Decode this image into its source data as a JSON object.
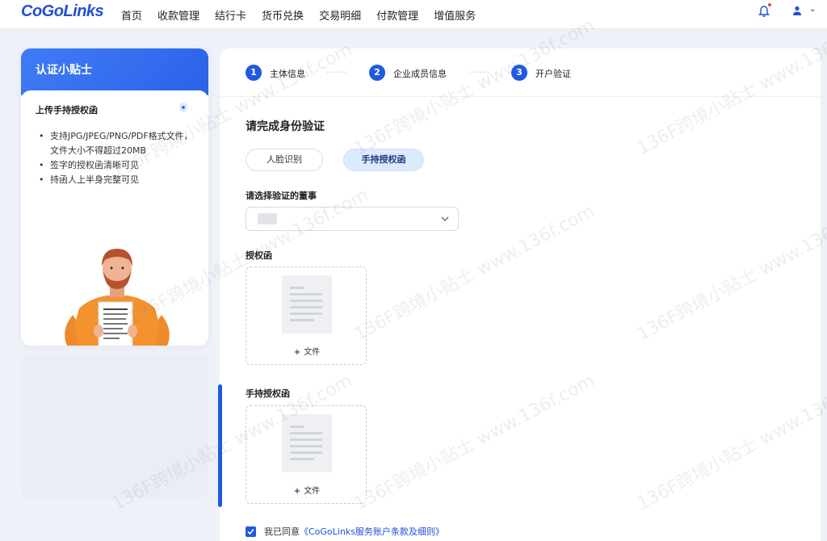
{
  "header": {
    "logo": "CoGoLinks",
    "nav": [
      "首页",
      "收款管理",
      "结行卡",
      "货币兑换",
      "交易明细",
      "付款管理",
      "增值服务"
    ],
    "icons": [
      "bell-icon",
      "user-icon",
      "chevron-down-icon"
    ]
  },
  "tips": {
    "title": "认证小贴士",
    "subtitle": "上传手持授权函",
    "items": [
      "支持JPG/JPEG/PNG/PDF格式文件，文件大小不得超过20MB",
      "签字的授权函清晰可见",
      "持函人上半身完整可见"
    ]
  },
  "steps": [
    {
      "num": "1",
      "label": "主体信息"
    },
    {
      "num": "2",
      "label": "企业成员信息"
    },
    {
      "num": "3",
      "label": "开户验证"
    }
  ],
  "step_separator": "······",
  "form": {
    "title": "请完成身份验证",
    "tabs": [
      {
        "label": "人脸识别",
        "active": false
      },
      {
        "label": "手持授权函",
        "active": true
      }
    ],
    "director_label": "请选择验证的董事",
    "auth_letter_label": "授权函",
    "handheld_label": "手持授权函",
    "upload_button": "文件",
    "agree_prefix": "我已同意",
    "agree_link": "《CoGoLinks服务账户条款及细则》"
  },
  "watermark": "136F跨境小贴士 www.136f.com",
  "colors": {
    "primary": "#1f5ae0",
    "header_gradient_start": "#3f7cf6",
    "tab_active_bg": "#dceaff",
    "page_bg": "#eef1f7"
  }
}
